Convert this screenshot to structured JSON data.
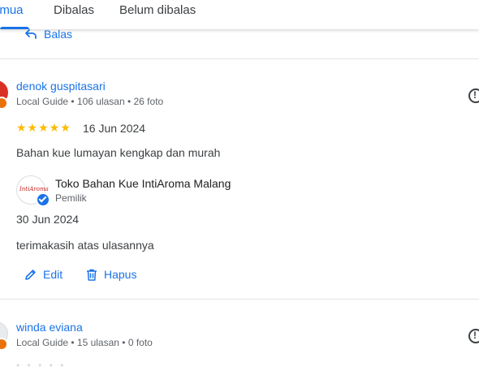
{
  "tabs": [
    {
      "label": "Semua",
      "visible_label": "emua",
      "active": true
    },
    {
      "label": "Dibalas",
      "active": false
    },
    {
      "label": "Belum dibalas",
      "active": false
    }
  ],
  "prev_review": {
    "reply_label": "Balas"
  },
  "reviews": [
    {
      "author": "denok guspitasari",
      "meta": "Local Guide • 106 ulasan • 26 foto",
      "rating": 5,
      "stars": "★★★★★",
      "date": "16 Jun 2024",
      "text": "Bahan kue lumayan kengkap dan murah",
      "owner_reply": {
        "name": "Toko Bahan Kue IntiAroma Malang",
        "role": "Pemilik",
        "logo_text": "IntiAroma",
        "date": "30 Jun 2024",
        "text": "terimakasih atas ulasannya"
      },
      "actions": {
        "edit": "Edit",
        "delete": "Hapus"
      }
    },
    {
      "author": "winda eviana",
      "meta": "Local Guide • 15 ulasan • 0 foto"
    }
  ],
  "colors": {
    "accent": "#1a73e8",
    "star": "#fbbc04",
    "text": "#3c4043",
    "muted": "#5f6368"
  }
}
